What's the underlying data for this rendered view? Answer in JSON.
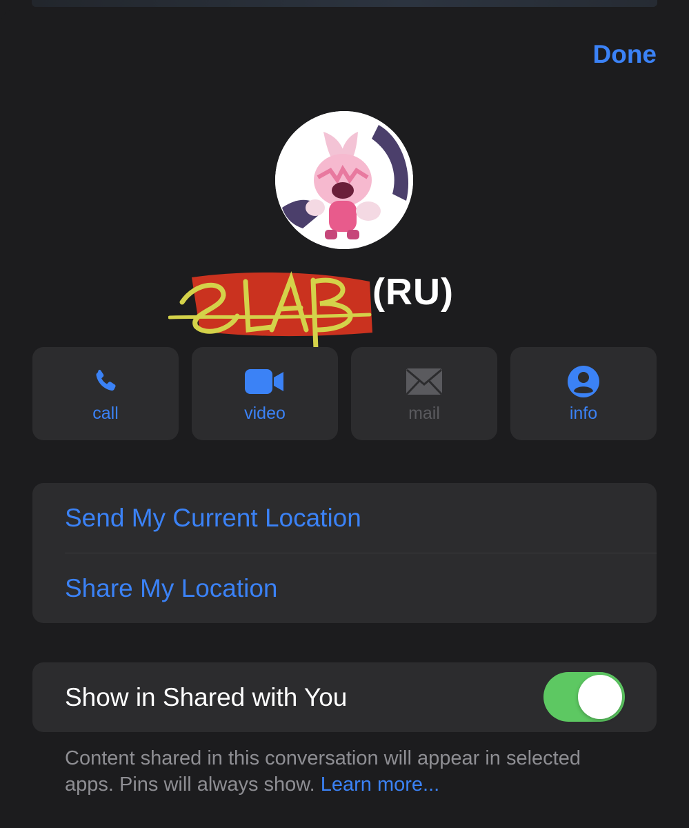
{
  "header": {
    "done_label": "Done"
  },
  "contact": {
    "name_scribbled": "SLAB",
    "name_suffix": "(RU)",
    "avatar_icon": "character-avatar"
  },
  "actions": [
    {
      "label": "call",
      "icon": "phone-icon",
      "enabled": true
    },
    {
      "label": "video",
      "icon": "video-camera-icon",
      "enabled": true
    },
    {
      "label": "mail",
      "icon": "envelope-icon",
      "enabled": false
    },
    {
      "label": "info",
      "icon": "person-circle-icon",
      "enabled": true
    }
  ],
  "location": {
    "send_current": "Send My Current Location",
    "share": "Share My Location"
  },
  "shared_with_you": {
    "label": "Show in Shared with You",
    "enabled": true
  },
  "footer": {
    "text": "Content shared in this conversation will appear in selected apps. Pins will always show. ",
    "learn_more": "Learn more..."
  },
  "colors": {
    "accent": "#3b82f6",
    "toggle_on": "#5dc862",
    "background": "#1c1c1e",
    "cell": "#2c2c2e"
  }
}
